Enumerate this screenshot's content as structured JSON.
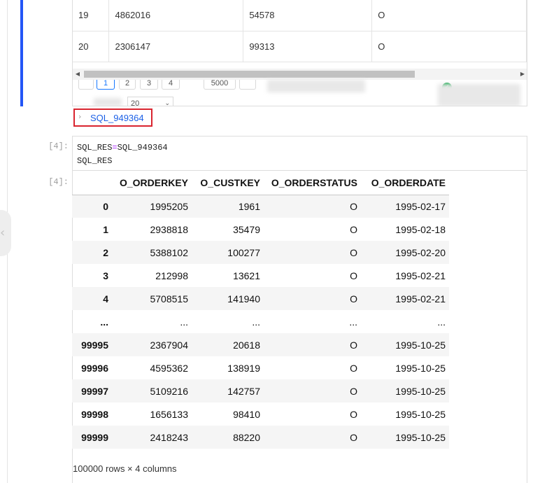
{
  "result_preview": {
    "rows": [
      [
        "19",
        "4862016",
        "54578",
        "O"
      ],
      [
        "20",
        "2306147",
        "99313",
        "O"
      ]
    ],
    "pagination": {
      "pages": [
        "1",
        "2",
        "3",
        "4"
      ],
      "active_page": "1",
      "total": "5000",
      "page_size": "20"
    }
  },
  "sql_link": {
    "label": "SQL_949364"
  },
  "cell": {
    "in_prompt": "[4]:",
    "out_prompt": "[4]:",
    "code_var": "SQL_RES",
    "code_eq": "=",
    "code_value": "SQL_949364",
    "code_line2": "SQL_RES"
  },
  "dataframe": {
    "columns": [
      "O_ORDERKEY",
      "O_CUSTKEY",
      "O_ORDERSTATUS",
      "O_ORDERDATE"
    ],
    "rows": [
      [
        "0",
        "1995205",
        "1961",
        "O",
        "1995-02-17"
      ],
      [
        "1",
        "2938818",
        "35479",
        "O",
        "1995-02-18"
      ],
      [
        "2",
        "5388102",
        "100277",
        "O",
        "1995-02-20"
      ],
      [
        "3",
        "212998",
        "13621",
        "O",
        "1995-02-21"
      ],
      [
        "4",
        "5708515",
        "141940",
        "O",
        "1995-02-21"
      ],
      [
        "...",
        "...",
        "...",
        "...",
        "..."
      ],
      [
        "99995",
        "2367904",
        "20618",
        "O",
        "1995-10-25"
      ],
      [
        "99996",
        "4595362",
        "138919",
        "O",
        "1995-10-25"
      ],
      [
        "99997",
        "5109216",
        "142757",
        "O",
        "1995-10-25"
      ],
      [
        "99998",
        "1656133",
        "98410",
        "O",
        "1995-10-25"
      ],
      [
        "99999",
        "2418243",
        "88220",
        "O",
        "1995-10-25"
      ]
    ],
    "shape_text": "100000 rows × 4 columns"
  },
  "icons": {
    "collapse_arrow": "chevron-right-icon",
    "status": "check-circle-icon",
    "side": "chevron-left-icon"
  },
  "colors": {
    "cell_bar": "#2356f6",
    "link": "#1a5fe6",
    "highlight_box": "#d9242f",
    "success": "#13a84a"
  }
}
